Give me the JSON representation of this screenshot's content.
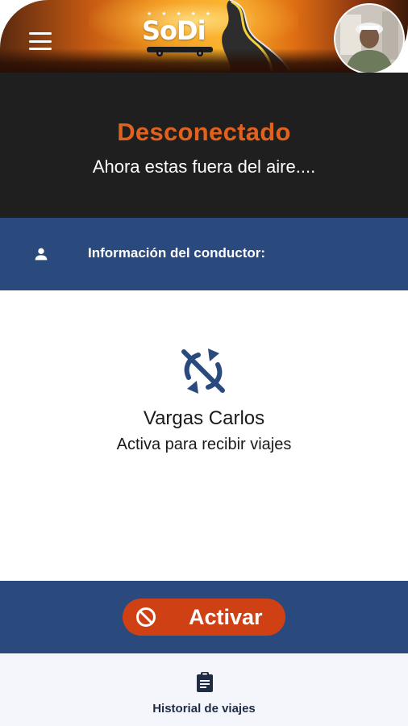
{
  "header": {
    "logo_text": "SoDi",
    "logo_stars": "★ ★ ★ ★ ★",
    "menu_icon": "hamburger-menu-icon",
    "avatar_icon": "driver-avatar"
  },
  "status": {
    "title": "Desconectado",
    "subtitle": "Ahora estas fuera del aire....",
    "title_color": "#e0621c"
  },
  "info_bar": {
    "icon": "person-icon",
    "label": "Información del conductor:"
  },
  "driver": {
    "icon": "sync-disabled-icon",
    "name": "Vargas Carlos",
    "status_text": "Activa para recibir viajes"
  },
  "action": {
    "icon": "ban-icon",
    "label": "Activar",
    "button_color": "#cf4114"
  },
  "bottom_nav": {
    "items": [
      {
        "icon": "clipboard-icon",
        "label": "Historial de viajes"
      }
    ]
  },
  "colors": {
    "dark_panel": "#1f1f1f",
    "brand_blue": "#2a4a7d",
    "accent_orange": "#e0621c"
  }
}
